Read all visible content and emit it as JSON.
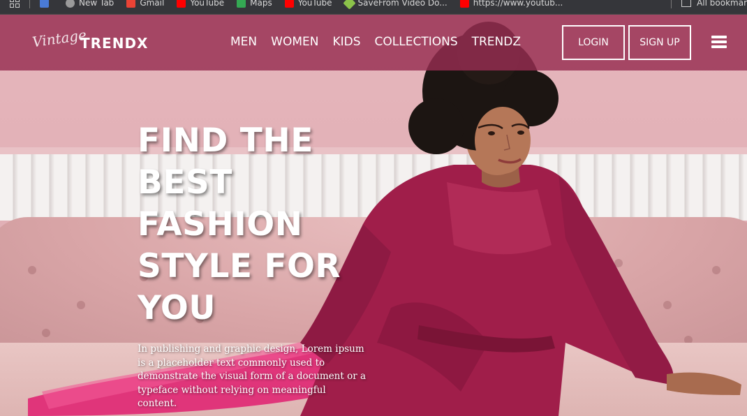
{
  "browser": {
    "bookmarks": [
      {
        "label": "",
        "icon": "docs-icon",
        "color": "#4a7bd6"
      },
      {
        "label": "New Tab",
        "icon": "globe-icon",
        "color": "#9a9a9a"
      },
      {
        "label": "Gmail",
        "icon": "gmail-icon",
        "color": "#ea4335"
      },
      {
        "label": "YouTube",
        "icon": "youtube-icon",
        "color": "#ff0000"
      },
      {
        "label": "Maps",
        "icon": "maps-icon",
        "color": "#34a853"
      },
      {
        "label": "YouTube",
        "icon": "youtube-icon",
        "color": "#ff0000"
      },
      {
        "label": "SaveFrom Video Do...",
        "icon": "savefrom-icon",
        "color": "#8bc34a"
      },
      {
        "label": "https://www.youtub...",
        "icon": "youtube-icon",
        "color": "#ff0000"
      }
    ],
    "all_bookmarks_label": "All bookmar"
  },
  "nav": {
    "logo_script": "Vintage",
    "logo_main": "TRENDX",
    "links": [
      "MEN",
      "WOMEN",
      "KIDS",
      "COLLECTIONS",
      "TRENDZ"
    ],
    "login_label": "LOGIN",
    "signup_label": "SIGN UP",
    "menu_icon": "hamburger-menu-icon",
    "bg_color": "#962d50"
  },
  "hero": {
    "headline_lines": [
      "FIND THE",
      "BEST",
      "FASHION",
      "STYLE FOR",
      "YOU"
    ],
    "description": "In publishing and graphic design, Lorem ipsum is a placeholder text commonly used to demonstrate the visual form of a document or a typeface without relying on meaningful content.",
    "dress_color": "#a01e4a",
    "wall_color": "#e3b2b8"
  }
}
